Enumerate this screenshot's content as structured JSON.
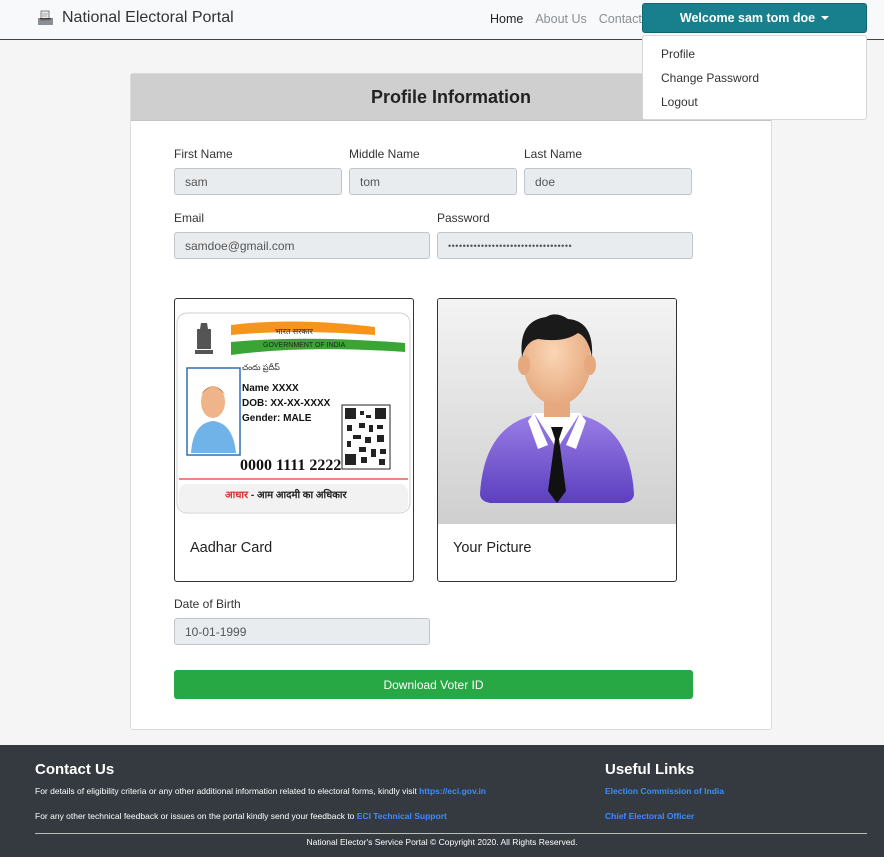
{
  "navbar": {
    "brand": "National Electoral Portal",
    "links": [
      "Home",
      "About Us",
      "Contact"
    ],
    "welcome": "Welcome sam tom doe",
    "dropdown": [
      "Profile",
      "Change Password",
      "Logout"
    ]
  },
  "profile": {
    "title": "Profile Information",
    "first_name_label": "First Name",
    "first_name": "sam",
    "middle_name_label": "Middle Name",
    "middle_name": "tom",
    "last_name_label": "Last Name",
    "last_name": "doe",
    "email_label": "Email",
    "email": "samdoe@gmail.com",
    "password_label": "Password",
    "password": "••••••••••••••••••••••••••••••••••",
    "aadhar_caption": "Aadhar Card",
    "picture_caption": "Your Picture",
    "dob_label": "Date of Birth",
    "dob": "10-01-1999",
    "download_button": "Download Voter ID"
  },
  "aadhar": {
    "govt_hindi": "भारत सरकार",
    "govt_english": "GOVERNMENT OF INDIA",
    "telugu": "చందు ప్రదీప్",
    "name": "Name XXXX",
    "dob": "DOB: XX-XX-XXXX",
    "gender": "Gender: MALE",
    "number": "0000 1111 2222",
    "tagline_red": "आधार",
    "tagline": " - आम आदमी का अधिकार"
  },
  "footer": {
    "contact_title": "Contact Us",
    "contact_line1": "For details of eligibility criteria or any other additional information related to electoral forms, kindly visit ",
    "contact_link1": "https://eci.gov.in",
    "contact_line2": "For any other technical feedback or issues on the portal kindly send your feedback to ",
    "contact_link2": "ECI Technical Support",
    "useful_title": "Useful Links",
    "useful_links": [
      "Election Commission of India",
      "Chief Electoral Officer"
    ],
    "copyright": "National Elector's Service Portal © Copyright 2020. All Rights Reserved."
  },
  "colors": {
    "welcome_bg": "#17808c",
    "download_bg": "#28a745",
    "footer_bg": "#343a40",
    "link": "#3a8dff"
  }
}
